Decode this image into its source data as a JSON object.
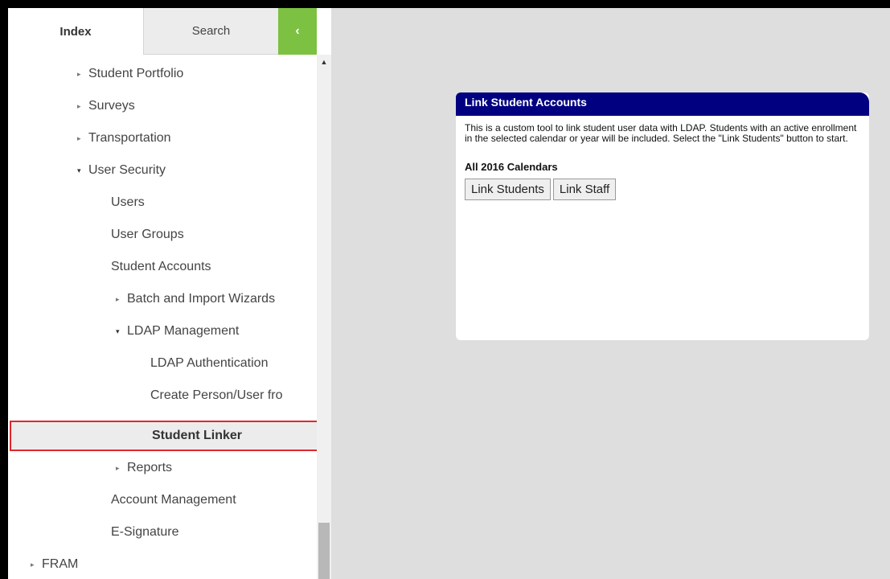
{
  "tabs": {
    "index_label": "Index",
    "search_label": "Search",
    "collapse_glyph": "‹"
  },
  "tree": {
    "items": [
      {
        "label": "Student Portfolio",
        "arrow": "▸"
      },
      {
        "label": "Surveys",
        "arrow": "▸"
      },
      {
        "label": "Transportation",
        "arrow": "▸"
      },
      {
        "label": "User Security",
        "arrow": "▾"
      },
      {
        "label": "Users"
      },
      {
        "label": "User Groups"
      },
      {
        "label": "Student Accounts"
      },
      {
        "label": "Batch and Import Wizards",
        "arrow": "▸"
      },
      {
        "label": "LDAP Management",
        "arrow": "▾"
      },
      {
        "label": "LDAP Authentication"
      },
      {
        "label": "Create Person/User fro"
      },
      {
        "label": "Student Linker",
        "selected": true
      },
      {
        "label": "Reports",
        "arrow": "▸"
      },
      {
        "label": "Account Management"
      },
      {
        "label": "E-Signature"
      },
      {
        "label": "FRAM",
        "arrow": "▸"
      }
    ]
  },
  "scrollbar": {
    "up_glyph": "▲"
  },
  "panel": {
    "title": "Link Student Accounts",
    "description": "This is a custom tool to link student user data with LDAP. Students with an active enrollment in the selected calendar or year will be included. Select the \"Link Students\" button to start.",
    "calendar_label": "All 2016 Calendars",
    "link_students_label": "Link Students",
    "link_staff_label": "Link Staff"
  },
  "colors": {
    "header_bg": "#000080",
    "collapse_bg": "#7cc142",
    "selected_border": "#e0272b"
  }
}
